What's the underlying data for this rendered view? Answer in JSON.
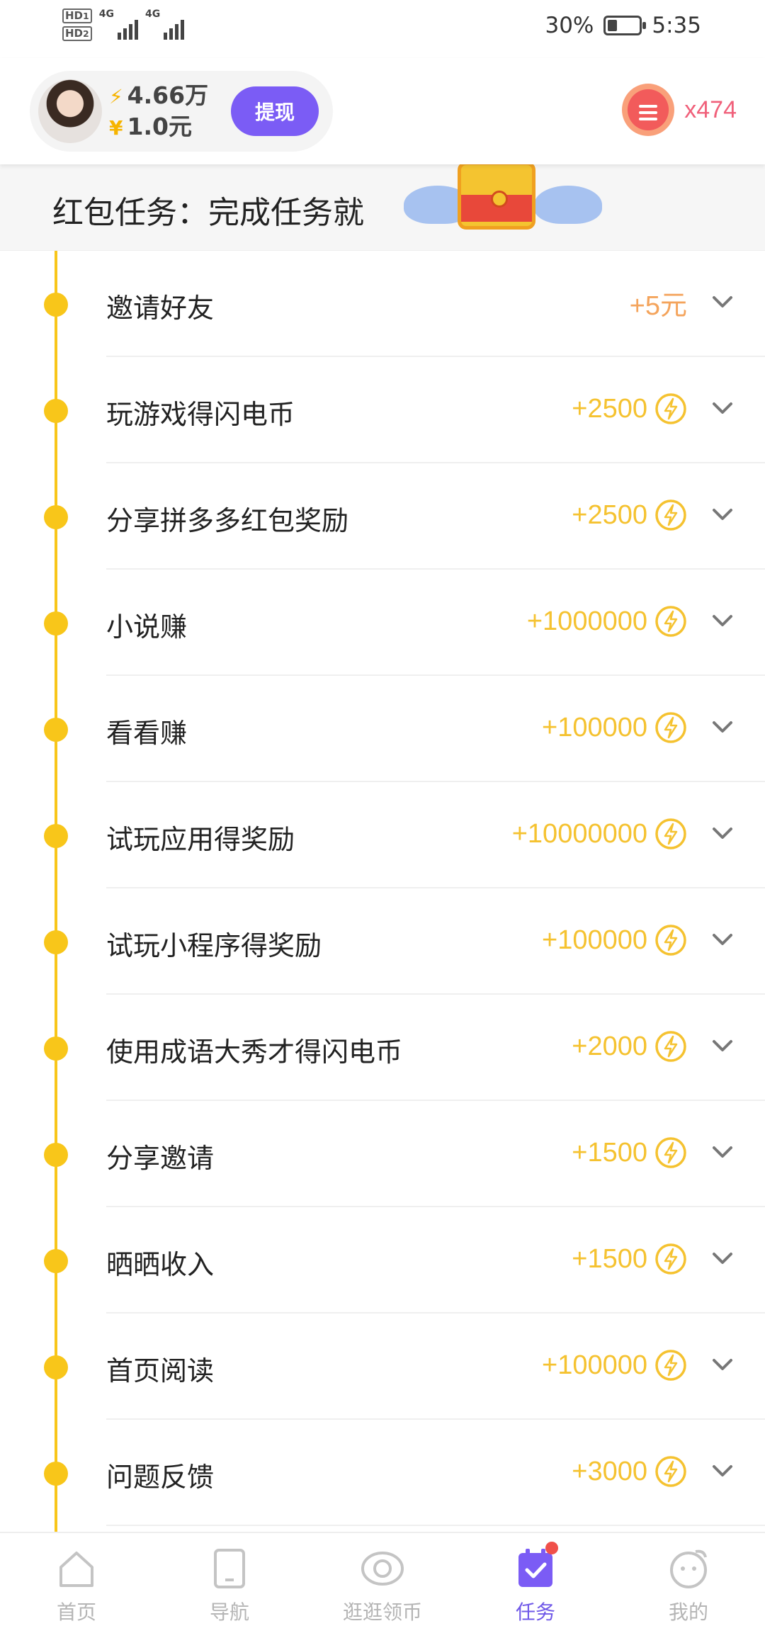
{
  "status_bar": {
    "sim1": "HD",
    "sim1_index": "1",
    "sim2": "HD",
    "sim2_index": "2",
    "network1": "4G",
    "network2": "4G",
    "battery_percent": "30%",
    "battery_level": 0.3,
    "time": "5:35"
  },
  "header": {
    "coins": "4.66万",
    "coin_icon": "lightning-icon",
    "cash": "1.0元",
    "cash_symbol": "¥",
    "withdraw_label": "提现",
    "box_count": "x474",
    "accent_color": "#7b5cf5"
  },
  "banner": {
    "title": "红包任务：完成任务就"
  },
  "tasks": [
    {
      "name": "邀请好友",
      "reward": "+5元",
      "type": "cash"
    },
    {
      "name": "玩游戏得闪电币",
      "reward": "+2500",
      "type": "coin"
    },
    {
      "name": "分享拼多多红包奖励",
      "reward": "+2500",
      "type": "coin"
    },
    {
      "name": "小说赚",
      "reward": "+1000000",
      "type": "coin"
    },
    {
      "name": "看看赚",
      "reward": "+100000",
      "type": "coin"
    },
    {
      "name": "试玩应用得奖励",
      "reward": "+10000000",
      "type": "coin"
    },
    {
      "name": "试玩小程序得奖励",
      "reward": "+100000",
      "type": "coin"
    },
    {
      "name": "使用成语大秀才得闪电币",
      "reward": "+2000",
      "type": "coin"
    },
    {
      "name": "分享邀请",
      "reward": "+1500",
      "type": "coin"
    },
    {
      "name": "晒晒收入",
      "reward": "+1500",
      "type": "coin"
    },
    {
      "name": "首页阅读",
      "reward": "+100000",
      "type": "coin"
    },
    {
      "name": "问题反馈",
      "reward": "+3000",
      "type": "coin"
    }
  ],
  "bottom_nav": [
    {
      "label": "首页",
      "icon": "home-icon"
    },
    {
      "label": "导航",
      "icon": "tablet-icon"
    },
    {
      "label": "逛逛领币",
      "icon": "eye-icon"
    },
    {
      "label": "任务",
      "icon": "task-check-icon",
      "active": true
    },
    {
      "label": "我的",
      "icon": "face-icon"
    }
  ]
}
